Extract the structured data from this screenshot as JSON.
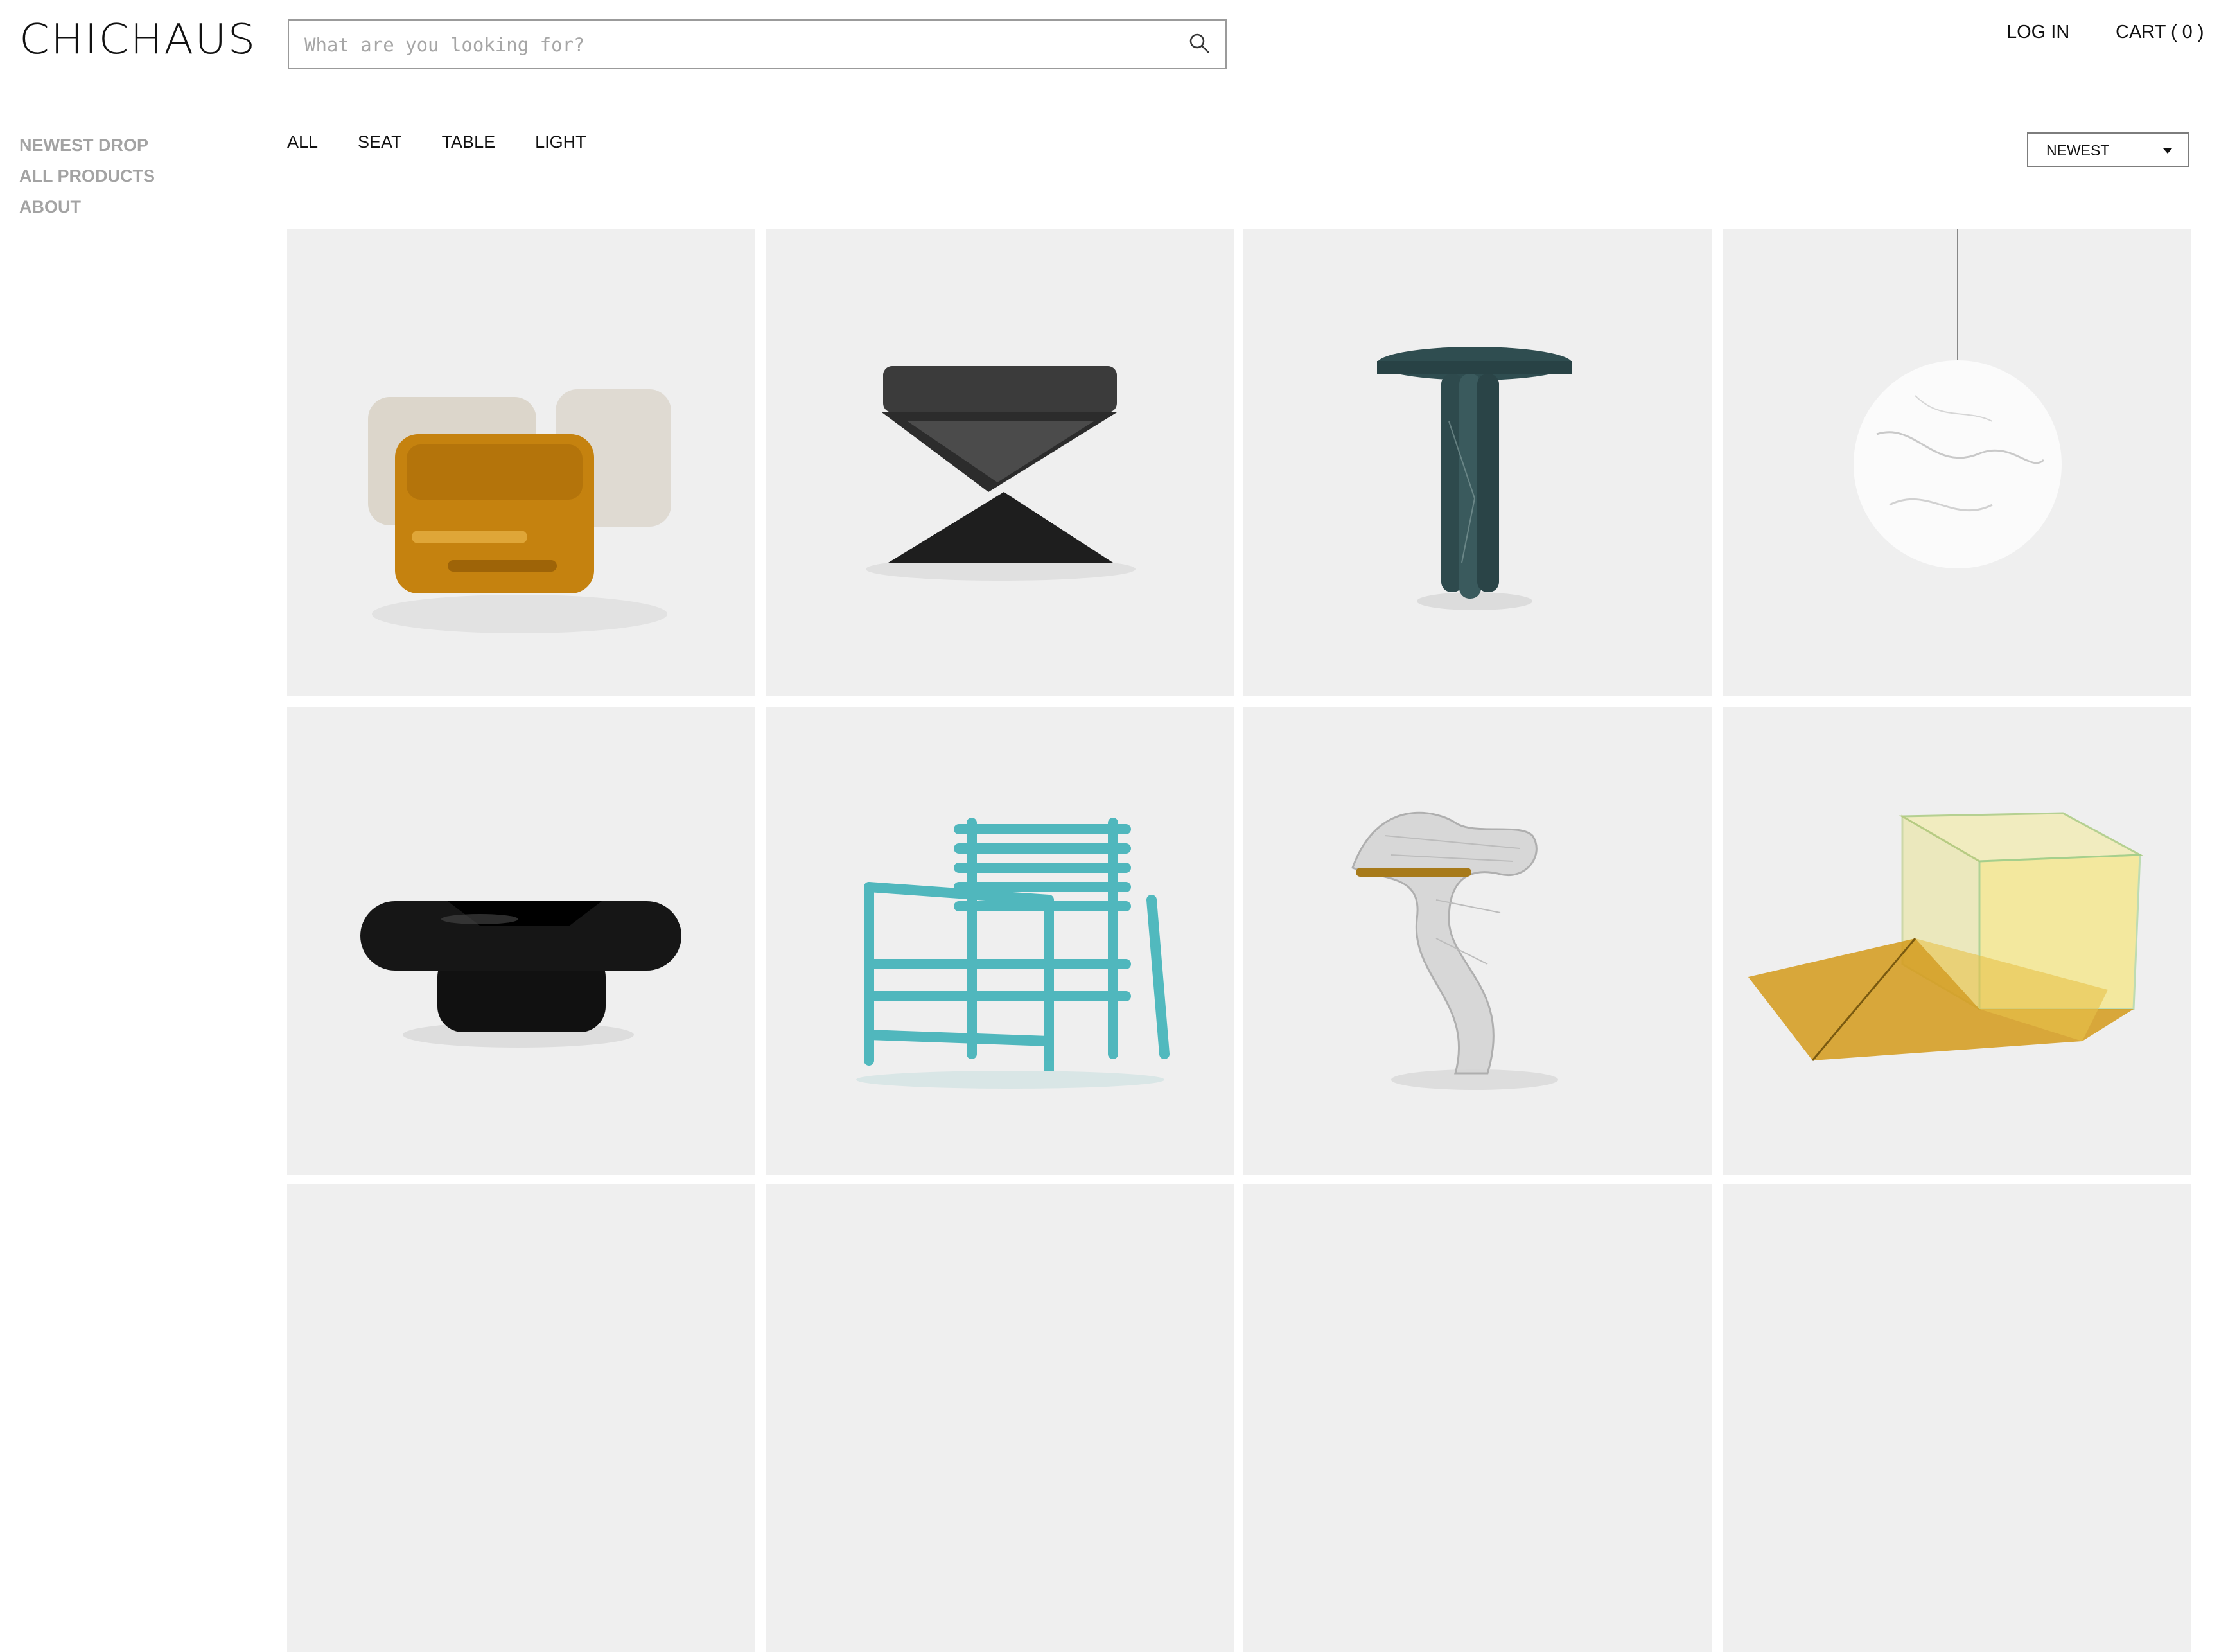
{
  "header": {
    "logo": "CHICHAUS",
    "search_placeholder": "What are you looking for?",
    "login": "LOG IN",
    "cart": "CART ( 0 )"
  },
  "sidebar": {
    "items": [
      {
        "label": "NEWEST DROP"
      },
      {
        "label": "ALL PRODUCTS"
      },
      {
        "label": "ABOUT"
      }
    ]
  },
  "filters": {
    "items": [
      {
        "label": "ALL"
      },
      {
        "label": "SEAT"
      },
      {
        "label": "TABLE"
      },
      {
        "label": "LIGHT"
      }
    ]
  },
  "sort": {
    "selected": "NEWEST"
  },
  "products": [
    {
      "icon": "amber-glass-cube-stool-image"
    },
    {
      "icon": "x-frame-stool-image"
    },
    {
      "icon": "green-marble-side-table-image"
    },
    {
      "icon": "marble-globe-pendant-light-image"
    },
    {
      "icon": "black-lacquer-coffee-table-image"
    },
    {
      "icon": "turquoise-glass-armchair-image"
    },
    {
      "icon": "mesh-wave-table-lamp-image"
    },
    {
      "icon": "iridescent-glass-cube-image"
    }
  ],
  "colors": {
    "tile_background": "#efefef",
    "sidebar_text": "#a3a3a3",
    "text": "#111111",
    "border": "#9b9b9b"
  }
}
